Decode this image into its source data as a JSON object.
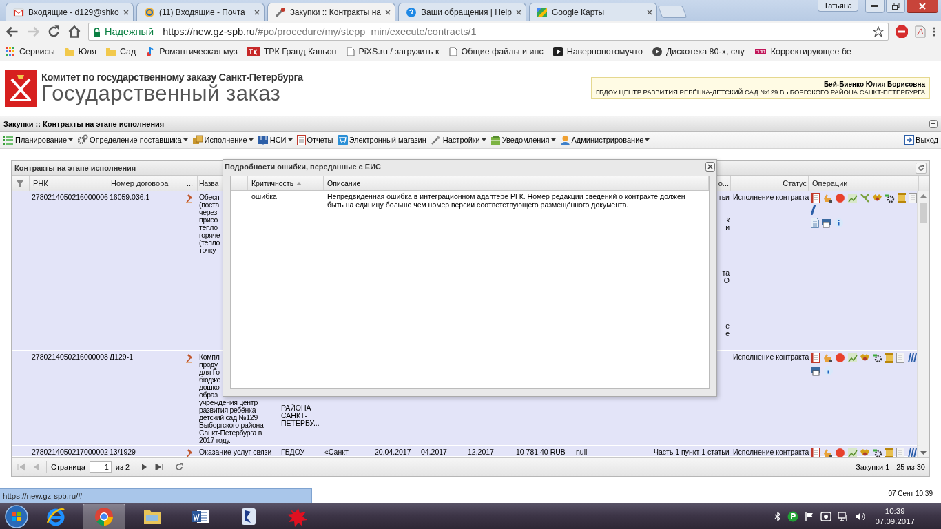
{
  "browser": {
    "tabs": [
      {
        "title": "Входящие - d129@shko",
        "kind": "mail",
        "selected": false
      },
      {
        "title": "(11) Входящие - Почта",
        "kind": "at",
        "selected": false
      },
      {
        "title": "Закупки :: Контракты на",
        "kind": "tools",
        "selected": true
      },
      {
        "title": "Ваши обращения | Help",
        "kind": "help",
        "selected": false
      },
      {
        "title": "Google Карты",
        "kind": "maps",
        "selected": false
      }
    ],
    "profile": "Татьяна",
    "nav": [
      {
        "kind": "back",
        "disabled": false
      },
      {
        "kind": "forward",
        "disabled": true
      },
      {
        "kind": "reload",
        "disabled": false
      },
      {
        "kind": "home",
        "disabled": false
      }
    ],
    "security": "Надежный",
    "url_host": "https://new.gz-spb.ru",
    "url_path": "/#po/procedure/my/stepp_min/execute/contracts/1",
    "bookmarks": [
      {
        "label": "Сервисы",
        "kind": "apps"
      },
      {
        "label": "Юля",
        "kind": "folder"
      },
      {
        "label": "Сад",
        "kind": "folder"
      },
      {
        "label": "Романтическая муз",
        "kind": "note"
      },
      {
        "label": "ТРК Гранд Каньон",
        "kind": "logo"
      },
      {
        "label": "PiXS.ru / загрузить к",
        "kind": "page"
      },
      {
        "label": "Общие файлы и инс",
        "kind": "page"
      },
      {
        "label": "Навернопотомучто",
        "kind": "play"
      },
      {
        "label": "Дискотека 80-х, слу",
        "kind": "disc"
      },
      {
        "label": "Корректирующее бе",
        "kind": "logo2"
      }
    ]
  },
  "header": {
    "org": "Комитет по государственному заказу Санкт-Петербурга",
    "title": "Государственный заказ",
    "user_name": "Бей-Биенко Юлия Борисовна",
    "user_org": "ГБДОУ ЦЕНТР РАЗВИТИЯ РЕБЁНКА-ДЕТСКИЙ САД №129 ВЫБОРГСКОГО РАЙОНА САНКТ-ПЕТЕРБУРГА"
  },
  "section_title": "Закупки :: Контракты на этапе исполнения",
  "menu": [
    {
      "label": "Планирование",
      "kind": "plan",
      "dropdown": true
    },
    {
      "label": "Определение поставщика",
      "kind": "gears",
      "dropdown": true
    },
    {
      "label": "Исполнение",
      "kind": "box",
      "dropdown": true
    },
    {
      "label": "НСИ",
      "kind": "book",
      "dropdown": true
    },
    {
      "label": "Отчеты",
      "kind": "report",
      "dropdown": false
    },
    {
      "label": "Электронный магазин",
      "kind": "cart",
      "dropdown": false
    },
    {
      "label": "Настройки",
      "kind": "wrench",
      "dropdown": true
    },
    {
      "label": "Уведомления",
      "kind": "bell",
      "dropdown": true
    },
    {
      "label": "Администрирование",
      "kind": "user",
      "dropdown": true
    }
  ],
  "logout": "Выход",
  "grid": {
    "title": "Контракты на этапе исполнения",
    "columns": [
      "РНК",
      "Номер договора",
      "...",
      "Назва",
      "о...",
      "Статус",
      "Операции"
    ],
    "rows": [
      {
        "rnk": "2780214050216000006",
        "number": "16059.036.1",
        "name": [
          "Обесп",
          "(поста",
          "через",
          "присо",
          "тепло",
          "горяче",
          "(тепло",
          "точку"
        ],
        "tail": [
          "тьи",
          "к",
          "и",
          "та",
          "О",
          "е",
          "е"
        ],
        "status": "Исполнение контракта"
      },
      {
        "rnk": "2780214050216000008",
        "number": "Д129-1",
        "name": [
          "Компл",
          "проду",
          "для Го",
          "бюдже",
          "дошко",
          "образ",
          "учреждения центр",
          "развития ребёнка -",
          "детский сад №129",
          "Выборгского района",
          "Санкт-Петербурга в",
          "2017 году."
        ],
        "customer": [
          "РАЙОНА",
          "САНКТ-",
          "ПЕТЕРБУ..."
        ],
        "status": "Исполнение контракта"
      },
      {
        "rnk": "2780214050217000002",
        "number": "13/1929",
        "name": [
          "Оказание услуг связи"
        ],
        "customer": [
          "ГБДОУ"
        ],
        "cells": [
          "«Санкт-",
          "20.04.2017",
          "04.2017",
          "12.2017",
          "10 781,40 RUB",
          "null",
          "Часть 1 пункт 1 статьи"
        ],
        "status": "Исполнение контракта"
      }
    ]
  },
  "pager": {
    "nav": [
      {
        "kind": "first",
        "disabled": true
      },
      {
        "kind": "prev",
        "disabled": true
      },
      {
        "kind": "next",
        "disabled": false
      },
      {
        "kind": "last",
        "disabled": false
      }
    ],
    "page_label": "Страница",
    "page": "1",
    "of": "из 2",
    "summary": "Закупки 1 - 25 из 30"
  },
  "dialog": {
    "title": "Подробности ошибки, переданные с ЕИС",
    "columns": [
      {
        "label": "Критичность",
        "sorted": true
      },
      {
        "label": "Описание",
        "sorted": false
      }
    ],
    "rows": [
      {
        "severity": "ошибка",
        "description": "Непредвиденная ошибка в интеграционном адаптере РГК. Номер редакции сведений о контракте должен быть на единицу больше чем номер версии соответствующего размещённого документа."
      }
    ]
  },
  "status_link": "https://new.gz-spb.ru/#",
  "footer_time": "07 Сент 10:39",
  "taskbar": {
    "apps": [
      {
        "kind": "ie",
        "active": false
      },
      {
        "kind": "chrome",
        "active": true
      },
      {
        "kind": "explorer",
        "active": false
      },
      {
        "kind": "word",
        "active": false
      },
      {
        "kind": "app",
        "active": false
      },
      {
        "kind": "splash",
        "active": false
      }
    ],
    "time": "10:39",
    "date": "07.09.2017"
  }
}
